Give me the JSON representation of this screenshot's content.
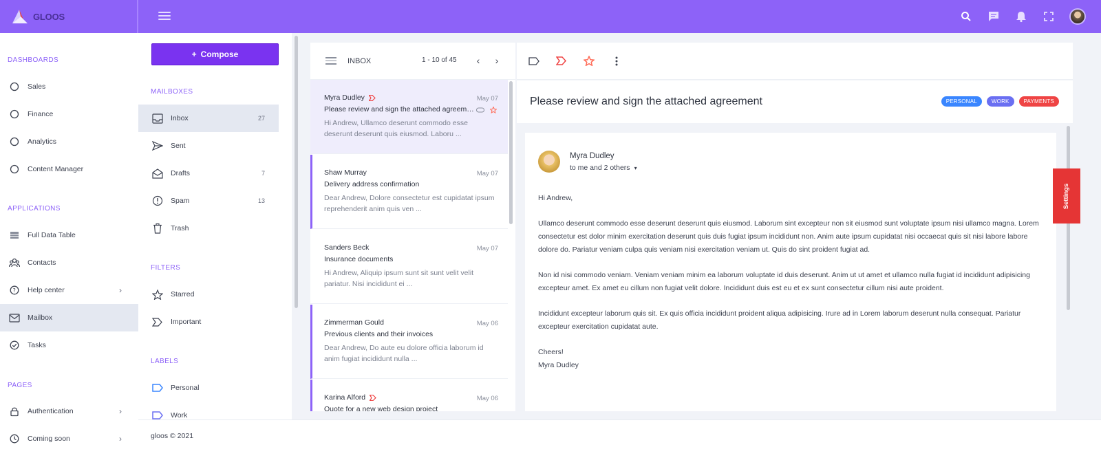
{
  "brand": {
    "name": "GLOOS"
  },
  "sidebar": {
    "sections": [
      {
        "label": "DASHBOARDS"
      },
      {
        "label": "APPLICATIONS"
      },
      {
        "label": "PAGES"
      }
    ],
    "items": [
      {
        "label": "Sales",
        "icon": "circle-icon"
      },
      {
        "label": "Finance",
        "icon": "circle-icon"
      },
      {
        "label": "Analytics",
        "icon": "circle-icon"
      },
      {
        "label": "Content Manager",
        "icon": "circle-icon"
      },
      {
        "label": "Full Data Table",
        "icon": "table-icon"
      },
      {
        "label": "Contacts",
        "icon": "contacts-icon"
      },
      {
        "label": "Help center",
        "icon": "help-icon"
      },
      {
        "label": "Mailbox",
        "icon": "mail-icon",
        "active": true
      },
      {
        "label": "Tasks",
        "icon": "check-circle-icon"
      },
      {
        "label": "Authentication",
        "icon": "lock-icon"
      },
      {
        "label": "Coming soon",
        "icon": "clock-icon"
      }
    ]
  },
  "mail": {
    "compose_label": "Compose",
    "sections": {
      "mailboxes": "MAILBOXES",
      "filters": "FILTERS",
      "labels": "LABELS"
    },
    "mailboxes": [
      {
        "label": "Inbox",
        "count": "27"
      },
      {
        "label": "Sent",
        "count": ""
      },
      {
        "label": "Drafts",
        "count": "7"
      },
      {
        "label": "Spam",
        "count": "13"
      },
      {
        "label": "Trash",
        "count": ""
      }
    ],
    "filters": [
      {
        "label": "Starred"
      },
      {
        "label": "Important"
      }
    ],
    "labels": [
      {
        "label": "Personal",
        "color": "#3a86ff"
      },
      {
        "label": "Work",
        "color": "#6a6ff2"
      }
    ]
  },
  "list": {
    "title": "INBOX",
    "range": "1 - 10 of 45",
    "messages": [
      {
        "from": "Myra Dudley",
        "date": "May 07",
        "subject": "Please review and sign the attached agreement",
        "preview": "Hi Andrew, Ullamco deserunt commodo esse deserunt deserunt quis eiusmod. Laboru ..."
      },
      {
        "from": "Shaw Murray",
        "date": "May 07",
        "subject": "Delivery address confirmation",
        "preview": "Dear Andrew, Dolore consectetur est cupidatat ipsum reprehenderit anim quis ven ..."
      },
      {
        "from": "Sanders Beck",
        "date": "May 07",
        "subject": "Insurance documents",
        "preview": "Hi Andrew, Aliquip ipsum sunt sit sunt velit velit pariatur. Nisi incididunt ei ..."
      },
      {
        "from": "Zimmerman Gould",
        "date": "May 06",
        "subject": "Previous clients and their invoices",
        "preview": "Dear Andrew, Do aute eu dolore officia laborum id anim fugiat incididunt nulla ..."
      },
      {
        "from": "Karina Alford",
        "date": "May 06",
        "subject": "Quote for a new web design project",
        "preview": ""
      }
    ]
  },
  "reader": {
    "subject": "Please review and sign the attached agreement",
    "tags": [
      {
        "label": "PERSONAL",
        "color": "#3a86ff"
      },
      {
        "label": "WORK",
        "color": "#6a6ff2"
      },
      {
        "label": "PAYMENTS",
        "color": "#ef4444"
      }
    ],
    "sender": "Myra Dudley",
    "recipients": "to me and 2 others",
    "greeting": "Hi Andrew,",
    "paragraphs": [
      "Ullamco deserunt commodo esse deserunt deserunt quis eiusmod. Laborum sint excepteur non sit eiusmod sunt voluptate ipsum nisi ullamco magna. Lorem consectetur est dolor minim exercitation deserunt quis duis fugiat ipsum incididunt non. Anim aute ipsum cupidatat nisi occaecat quis sit nisi labore labore dolore do. Pariatur veniam culpa quis veniam nisi exercitation veniam ut. Quis do sint proident fugiat ad.",
      "Non id nisi commodo veniam. Veniam veniam minim ea laborum voluptate id duis deserunt. Anim ut ut amet et ullamco nulla fugiat id incididunt adipisicing excepteur amet. Ex amet eu cillum non fugiat velit dolore. Incididunt duis est eu et ex sunt consectetur cillum nisi aute proident.",
      "Incididunt excepteur laborum quis sit. Ex quis officia incididunt proident aliqua adipisicing. Irure ad in Lorem laborum deserunt nulla consequat. Pariatur excepteur exercitation cupidatat aute."
    ],
    "closing": "Cheers!",
    "signature": "Myra Dudley"
  },
  "settings_tab": "Settings",
  "footer": "gloos © 2021",
  "colors": {
    "primary": "#8d62f8",
    "compose": "#7a33f0",
    "important": "#ef4444",
    "star": "#ff6b57"
  }
}
